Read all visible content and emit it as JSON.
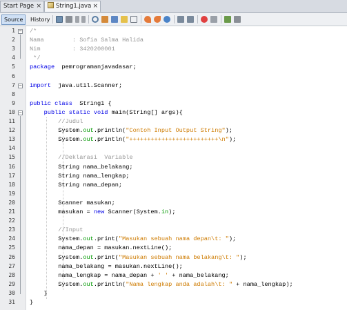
{
  "tabs": [
    {
      "label": "Start Page",
      "close": "×",
      "icon": "none"
    },
    {
      "label": "String1.java",
      "close": "×",
      "icon": "java-file-icon"
    }
  ],
  "toolbar": {
    "source_label": "Source",
    "history_label": "History",
    "icons": [
      "last-edit-icon",
      "back-icon",
      "forward-icon",
      "find-icon",
      "find-previous-icon",
      "find-next-icon",
      "toggle-highlight-icon",
      "toggle-rectangular-selection-icon",
      "previous-bookmark-icon",
      "next-bookmark-icon",
      "toggle-bookmark-icon",
      "shift-left-icon",
      "shift-right-icon",
      "start-macro-icon",
      "stop-macro-icon",
      "comment-icon",
      "uncomment-icon"
    ]
  },
  "code": {
    "line_numbers": [
      "1",
      "2",
      "3",
      "4",
      "5",
      "6",
      "7",
      "8",
      "9",
      "10",
      "11",
      "12",
      "13",
      "14",
      "15",
      "16",
      "17",
      "18",
      "19",
      "20",
      "21",
      "22",
      "23",
      "24",
      "25",
      "26",
      "27",
      "28",
      "29",
      "30",
      "31"
    ],
    "lines": [
      [
        [
          "cm",
          "/*"
        ]
      ],
      [
        [
          "cm",
          "Nama        : Sofia Salma Halida"
        ]
      ],
      [
        [
          "cm",
          "Nim         : 3420200001"
        ]
      ],
      [
        [
          "cm",
          " */"
        ]
      ],
      [
        [
          "kw",
          "package"
        ],
        [
          "",
          "  pemrogramanjavadasar;"
        ]
      ],
      [],
      [
        [
          "kw",
          "import"
        ],
        [
          "",
          "  java.util.Scanner;"
        ]
      ],
      [],
      [
        [
          "kw",
          "public class"
        ],
        [
          "",
          "  String1 {"
        ]
      ],
      [
        [
          "",
          "    "
        ],
        [
          "kw",
          "public static void"
        ],
        [
          "",
          " main(String[] args){"
        ]
      ],
      [
        [
          "cm",
          "        //Judul"
        ]
      ],
      [
        [
          "",
          "        System."
        ],
        [
          "fld",
          "out"
        ],
        [
          "",
          ".println("
        ],
        [
          "str",
          "\"Contoh Input Output String\""
        ],
        [
          "",
          ");"
        ]
      ],
      [
        [
          "",
          "        System."
        ],
        [
          "fld",
          "out"
        ],
        [
          "",
          ".println("
        ],
        [
          "str",
          "\"+++++++++++++++++++++++++\\n\""
        ],
        [
          "",
          ");"
        ]
      ],
      [],
      [
        [
          "cm",
          "        //Deklarasi  Variable"
        ]
      ],
      [
        [
          "",
          "        String nama_belakang;"
        ]
      ],
      [
        [
          "",
          "        String nama_lengkap;"
        ]
      ],
      [
        [
          "",
          "        String nama_depan;"
        ]
      ],
      [],
      [
        [
          "",
          "        Scanner masukan;"
        ]
      ],
      [
        [
          "",
          "        masukan = "
        ],
        [
          "kw",
          "new"
        ],
        [
          "",
          " Scanner(System."
        ],
        [
          "fld",
          "in"
        ],
        [
          "",
          ");"
        ]
      ],
      [],
      [
        [
          "cm",
          "        //Input"
        ]
      ],
      [
        [
          "",
          "        System."
        ],
        [
          "fld",
          "out"
        ],
        [
          "",
          ".print("
        ],
        [
          "str",
          "\"Masukan sebuah nama depan\\t: \""
        ],
        [
          "",
          ");"
        ]
      ],
      [
        [
          "",
          "        nama_depan = masukan.nextLine();"
        ]
      ],
      [
        [
          "",
          "        System."
        ],
        [
          "fld",
          "out"
        ],
        [
          "",
          ".print("
        ],
        [
          "str",
          "\"Masukan sebuah nama belakang\\t: \""
        ],
        [
          "",
          ");"
        ]
      ],
      [
        [
          "",
          "        nama_belakang = masukan.nextLine();"
        ]
      ],
      [
        [
          "",
          "        nama_lengkap = nama_depan + "
        ],
        [
          "str",
          "' '"
        ],
        [
          "",
          " + nama_belakang;"
        ]
      ],
      [
        [
          "",
          "        System."
        ],
        [
          "fld",
          "out"
        ],
        [
          "",
          ".println("
        ],
        [
          "str",
          "\"Nama lengkap anda adalah\\t: \""
        ],
        [
          "",
          " + nama_lengkap);"
        ]
      ],
      [
        [
          "",
          "    }"
        ]
      ],
      [
        [
          "",
          "}"
        ]
      ]
    ]
  }
}
